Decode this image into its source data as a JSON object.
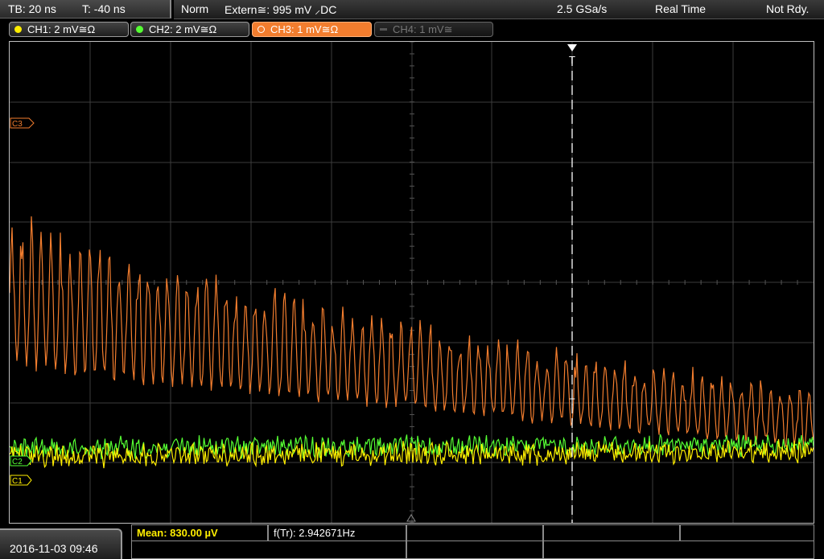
{
  "timebase": {
    "tb": "TB: 20 ns",
    "t": "T: -40 ns"
  },
  "status": {
    "mode": "Norm",
    "trigger": "Extern≅: 995 mV ⸝DC",
    "sample_rate": "2.5 GSa/s",
    "acquisition": "Real Time",
    "state": "Not Rdy."
  },
  "channels": [
    {
      "label": "CH1: 2 mV≅Ω",
      "color": "#ffee00",
      "active": true
    },
    {
      "label": "CH2: 2 mV≅Ω",
      "color": "#55ff33",
      "active": true
    },
    {
      "label": "CH3: 1 mV≅Ω",
      "color": "#f27d2e",
      "active": true,
      "selected": true
    },
    {
      "label": "CH4: 1 mV≅",
      "color": "#666666",
      "active": false
    }
  ],
  "markers": {
    "c3": "C3",
    "c1": "C1",
    "c2": "C2",
    "trigger": "T"
  },
  "datetime": "2016-11-03 09:46",
  "measurements": {
    "mean": "Mean: 830.00 µV",
    "freq": "f(Tr): 2.942671Hz"
  },
  "colors": {
    "ch1": "#ffee00",
    "ch2": "#55ff33",
    "ch3": "#f27d2e",
    "grid": "#3c3c3c",
    "trigger_line": "#ffffff"
  }
}
